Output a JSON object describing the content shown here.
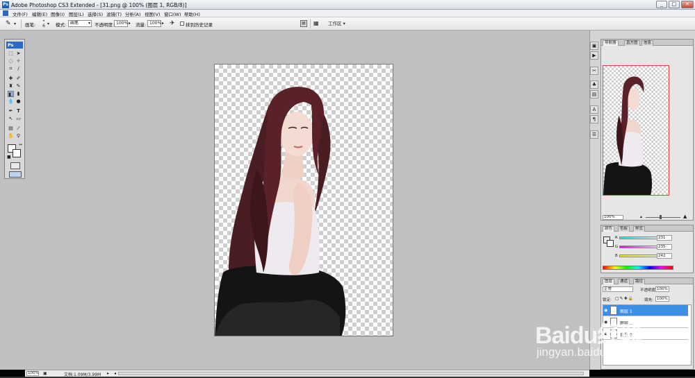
{
  "window": {
    "app_icon_text": "Ps",
    "title": "Adobe Photoshop CS3 Extended - [31.png @ 100% (图层 1, RGB/8)]",
    "controls": [
      "_",
      "□",
      "✕"
    ]
  },
  "menubar": {
    "items": [
      "文件(F)",
      "编辑(E)",
      "图像(I)",
      "图层(L)",
      "选择(S)",
      "滤镜(T)",
      "分析(A)",
      "视图(V)",
      "窗口(W)",
      "帮助(H)"
    ]
  },
  "options": {
    "brush_label": "画笔:",
    "brush_size": "6",
    "mode_label": "模式:",
    "mode_value": "画笔",
    "opacity_label": "不透明度:",
    "opacity_value": "100%",
    "flow_label": "流量:",
    "flow_value": "100%",
    "erase_history_label": "抹到历史记录",
    "workspace_label": "工作区 ▾"
  },
  "toolbox": {
    "badge": "Ps"
  },
  "navigator": {
    "tabs": [
      "导航器",
      "直方图",
      "信息"
    ],
    "zoom_value": "100%"
  },
  "color_panel": {
    "tabs": [
      "颜色",
      "色板",
      "样式"
    ],
    "channels": [
      {
        "label": "R",
        "value": "231"
      },
      {
        "label": "G",
        "value": "235"
      },
      {
        "label": "B",
        "value": "242"
      }
    ]
  },
  "layers_panel": {
    "tabs": [
      "图层",
      "通道",
      "路径"
    ],
    "blend_mode": "正常",
    "opacity_label": "不透明度:",
    "opacity_value": "100%",
    "lock_label": "锁定:",
    "fill_label": "填充:",
    "fill_value": "100%",
    "layers": [
      {
        "name": "图层 1",
        "selected": true
      },
      {
        "name": "图层...",
        "selected": false
      },
      {
        "name": "背景 0",
        "selected": false
      }
    ]
  },
  "status": {
    "zoom": "100%",
    "doc_info": "文档:1.09M/3.99M"
  },
  "watermark": {
    "main": "Baidu经验",
    "sub": "jingyan.baidu.com"
  },
  "colors": {
    "workspace_bg": "#c0c0c0",
    "selected_layer": "#3d8ee6",
    "navigator_frame": "#e34040"
  }
}
